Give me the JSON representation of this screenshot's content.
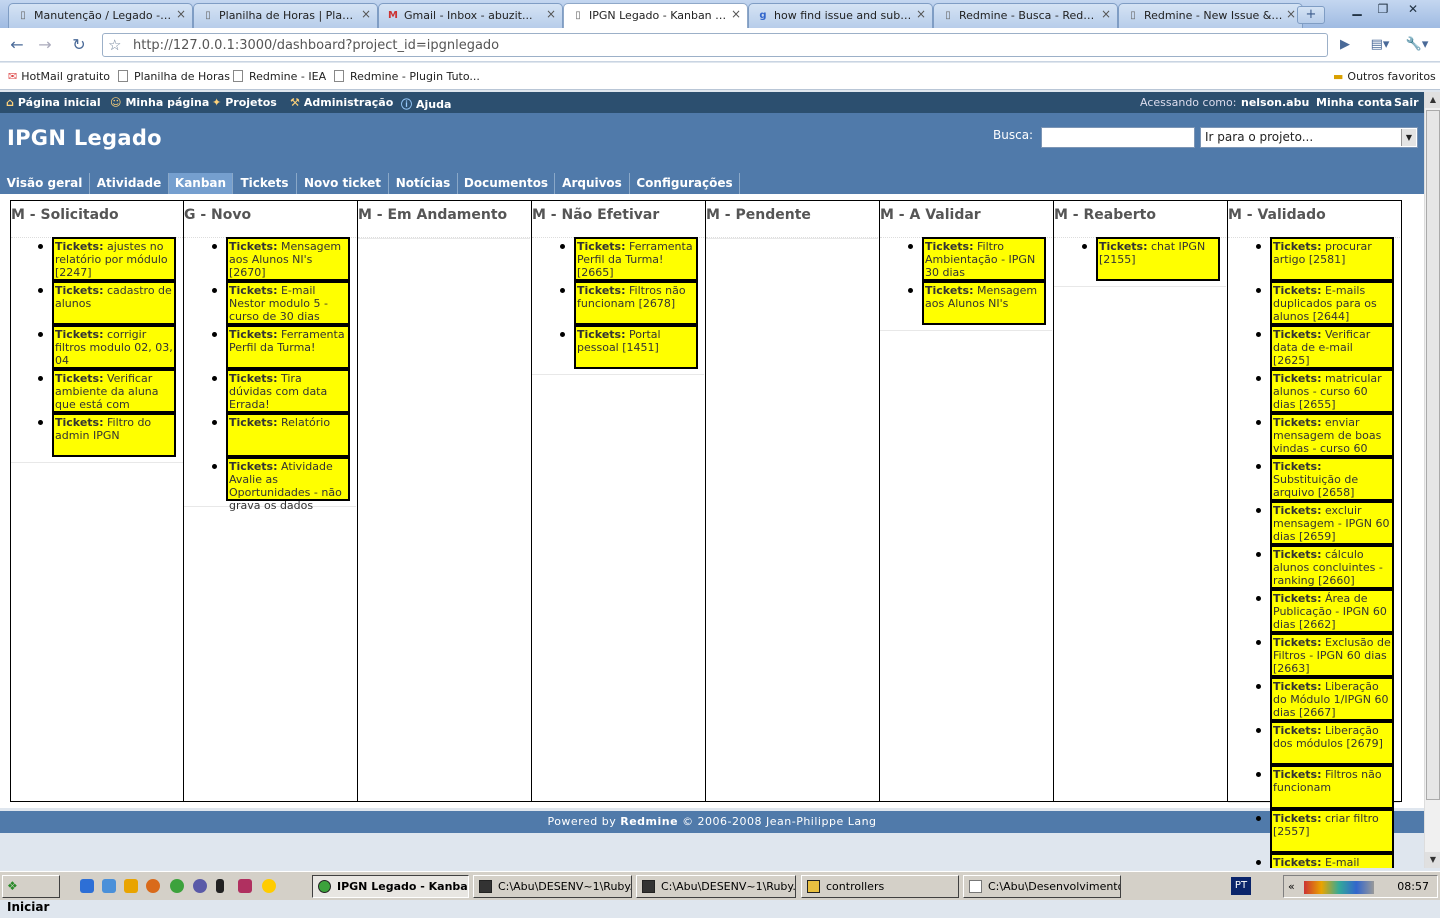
{
  "browser": {
    "tabs": [
      {
        "title": "Manutenção / Legado - T...",
        "icon": "page-icon"
      },
      {
        "title": "Planilha de Horas | Planil...",
        "icon": "page-icon"
      },
      {
        "title": "Gmail - Inbox - abuzit...",
        "icon": "gmail-icon"
      },
      {
        "title": "IPGN Legado - Kanban - ...",
        "icon": "page-icon",
        "active": true
      },
      {
        "title": "how find issue and subpr...",
        "icon": "google-icon"
      },
      {
        "title": "Redmine - Busca - Redmine",
        "icon": "page-icon"
      },
      {
        "title": "Redmine - New Issue &q...",
        "icon": "page-icon"
      }
    ],
    "url": "http://127.0.0.1:3000/dashboard?project_id=ipgnlegado",
    "bookmarks": [
      "HotMail gratuito",
      "Planilha de Horas",
      "Redmine - IEA",
      "Redmine - Plugin Tuto..."
    ],
    "other_bookmarks": "Outros favoritos"
  },
  "topmenu": {
    "items": [
      "Página inicial",
      "Minha página",
      "Projetos",
      "Administração",
      "Ajuda"
    ],
    "logged_as_label": "Acessando como:",
    "user": "nelson.abu",
    "my_account": "Minha conta",
    "logout": "Sair"
  },
  "header": {
    "title": "IPGN Legado",
    "search_label": "Busca:",
    "project_jump": "Ir para o projeto..."
  },
  "mainmenu": {
    "items": [
      "Visão geral",
      "Atividade",
      "Kanban",
      "Tickets",
      "Novo ticket",
      "Notícias",
      "Documentos",
      "Arquivos",
      "Configurações"
    ],
    "selected": "Kanban"
  },
  "board": {
    "prefix": "Tickets:",
    "columns": [
      {
        "title": "M - Solicitado",
        "cards": [
          "ajustes no relatório por módulo [2247]",
          "cadastro de alunos",
          "corrigir filtros modulo 02, 03, 04",
          "Verificar ambiente da aluna que está com",
          "Filtro do admin IPGN"
        ]
      },
      {
        "title": "G - Novo",
        "cards": [
          "Mensagem aos Alunos NI's [2670]",
          "E-mail Nestor modulo 5 - curso de 30 dias",
          "Ferramenta Perfil da Turma!",
          "Tira dúvidas com data Errada!",
          "Relatório",
          "Atividade Avalie as Oportunidades - não grava os dados"
        ]
      },
      {
        "title": "M - Em Andamento",
        "cards": []
      },
      {
        "title": "M - Não Efetivar",
        "cards": [
          "Ferramenta Perfil da Turma! [2665]",
          "Filtros não funcionam [2678]",
          "Portal pessoal [1451]"
        ]
      },
      {
        "title": "M - Pendente",
        "cards": []
      },
      {
        "title": "M - A Validar",
        "cards": [
          "Filtro Ambientação - IPGN 30 dias",
          "Mensagem aos Alunos NI's"
        ]
      },
      {
        "title": "M - Reaberto",
        "cards": [
          "chat IPGN [2155]"
        ]
      },
      {
        "title": "M - Validado",
        "cards": [
          "procurar artigo [2581]",
          "E-mails duplicados para os alunos [2644]",
          "Verificar data de e-mail [2625]",
          "matricular alunos - curso 60 dias [2655]",
          "enviar mensagem de boas vindas - curso 60",
          "Substituição de arquivo [2658]",
          "excluir mensagem - IPGN 60 dias [2659]",
          "cálculo alunos concluintes - ranking [2660]",
          "Área de Publicação - IPGN 60 dias [2662]",
          "Exclusão de Filtros - IPGN 60 dias [2663]",
          "Liberação do Módulo 1/IPGN 60 dias [2667]",
          "Liberação dos módulos [2679]",
          "Filtros não funcionam",
          "criar filtro [2557]",
          "E-mail"
        ]
      }
    ]
  },
  "footer": {
    "powered": "Powered by",
    "brand": "Redmine",
    "copy": "© 2006-2008 Jean-Philippe Lang"
  },
  "taskbar": {
    "start": "Iniciar",
    "tasks": [
      "IPGN Legado - Kanba...",
      "C:\\Abu\\DESENV~1\\Ruby...",
      "C:\\Abu\\DESENV~1\\Ruby...",
      "controllers",
      "C:\\Abu\\Desenvolvimento..."
    ],
    "lang": "PT",
    "clock": "08:57"
  }
}
